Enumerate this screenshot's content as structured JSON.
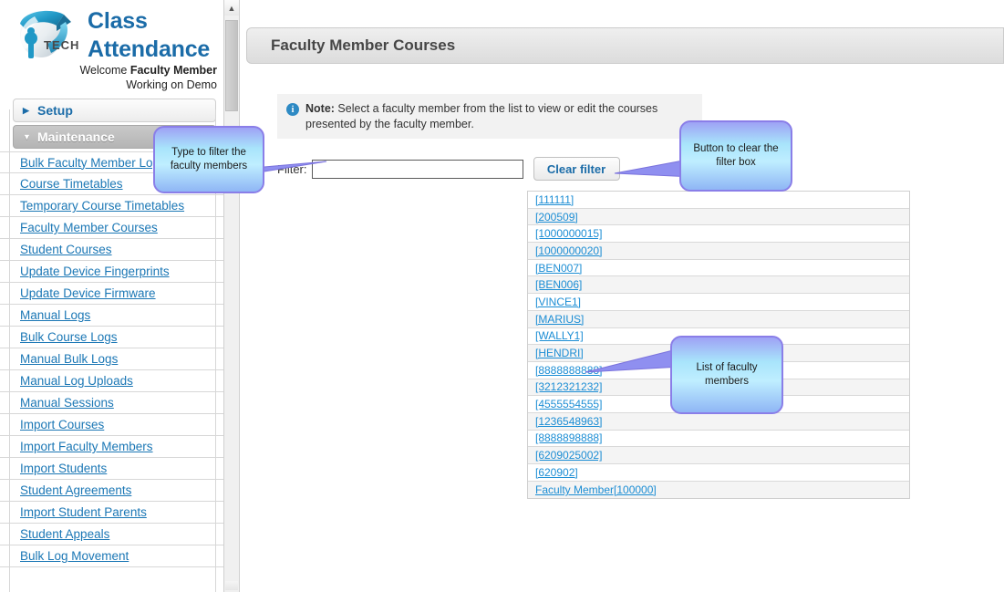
{
  "brand": {
    "logo_icon": "iptech-globe-logo",
    "title_line1": "Class",
    "title_line2": "Attendance",
    "welcome_prefix": "Welcome ",
    "welcome_name": "Faculty Member",
    "welcome_line2": "Working on Demo"
  },
  "sidebar": {
    "sections": [
      {
        "label": "Setup",
        "expanded": false,
        "arrow_icon": "chevron-right-icon"
      },
      {
        "label": "Maintenance",
        "expanded": true,
        "arrow_icon": "chevron-down-icon"
      }
    ],
    "items": [
      {
        "label": "Bulk Faculty Member Logs"
      },
      {
        "label": "Course Timetables"
      },
      {
        "label": "Temporary Course Timetables"
      },
      {
        "label": "Faculty Member Courses"
      },
      {
        "label": "Student Courses"
      },
      {
        "label": "Update Device Fingerprints"
      },
      {
        "label": "Update Device Firmware"
      },
      {
        "label": "Manual Logs"
      },
      {
        "label": "Bulk Course Logs"
      },
      {
        "label": "Manual Bulk Logs"
      },
      {
        "label": "Manual Log Uploads"
      },
      {
        "label": "Manual Sessions"
      },
      {
        "label": "Import Courses"
      },
      {
        "label": "Import Faculty Members"
      },
      {
        "label": "Import Students"
      },
      {
        "label": "Student Agreements"
      },
      {
        "label": "Import Student Parents"
      },
      {
        "label": "Student Appeals"
      },
      {
        "label": "Bulk Log Movement"
      }
    ]
  },
  "scrollbar": {
    "up_arrow_icon": "chevron-up-icon"
  },
  "main": {
    "page_title": "Faculty Member Courses",
    "note": {
      "icon": "info-icon",
      "icon_glyph": "i",
      "label": "Note:",
      "text": " Select a faculty member from the list to view or edit the courses presented by the faculty member."
    },
    "filter": {
      "label": "Filter:",
      "value": "",
      "placeholder": "",
      "clear_button_label": "Clear filter"
    },
    "faculty_list": [
      {
        "label": "[111111]"
      },
      {
        "label": "[200509]"
      },
      {
        "label": "[1000000015]"
      },
      {
        "label": "[1000000020]"
      },
      {
        "label": "[BEN007]"
      },
      {
        "label": "[BEN006]"
      },
      {
        "label": "[VINCE1]"
      },
      {
        "label": "[MARIUS]"
      },
      {
        "label": "[WALLY1]"
      },
      {
        "label": "[HENDRI]"
      },
      {
        "label": "[8888888888]"
      },
      {
        "label": "[3212321232]"
      },
      {
        "label": "[4555554555]"
      },
      {
        "label": "[1236548963]"
      },
      {
        "label": "[8888898888]"
      },
      {
        "label": "[6209025002]"
      },
      {
        "label": "[620902]"
      },
      {
        "label": "Faculty Member[100000]"
      }
    ]
  },
  "callouts": [
    {
      "id": "filter",
      "text": "Type to filter the faculty members"
    },
    {
      "id": "clear",
      "text": "Button to clear the filter box"
    },
    {
      "id": "list",
      "text": "List of faculty members"
    }
  ],
  "colors": {
    "brand_blue": "#1b6ca8",
    "link_blue": "#1b77b5",
    "list_link_blue": "#1b8dd4",
    "callout_border": "#8a7ee8",
    "info_icon_blue": "#2e8ac4"
  }
}
